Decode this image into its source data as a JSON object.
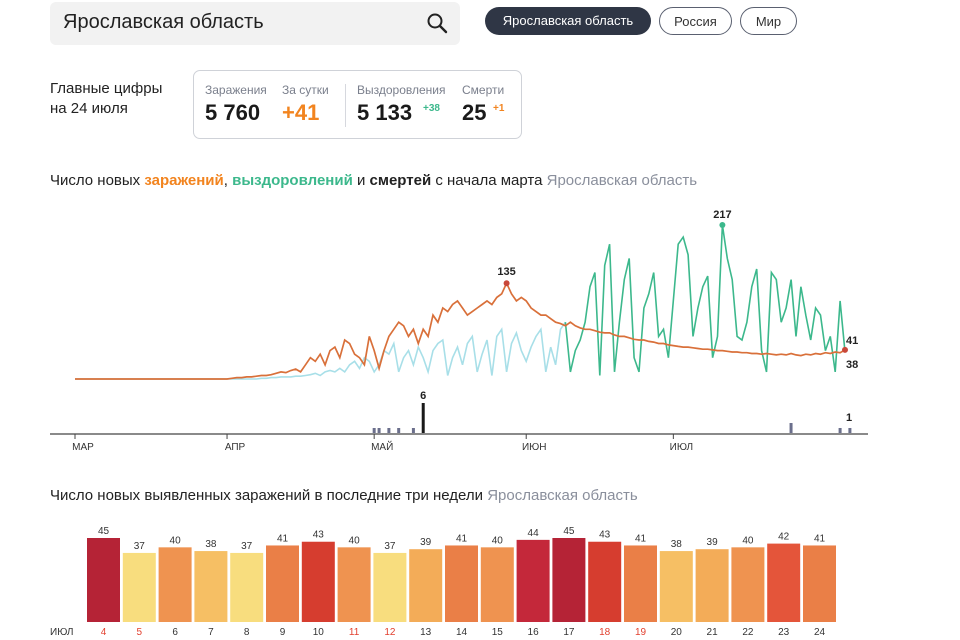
{
  "search": {
    "value": "Ярославская область"
  },
  "region_tabs": [
    {
      "label": "Ярославская область",
      "active": true
    },
    {
      "label": "Россия",
      "active": false
    },
    {
      "label": "Мир",
      "active": false
    }
  ],
  "stats": {
    "title_line1": "Главные цифры",
    "title_line2": "на 24 июля",
    "infections_label": "Заражения",
    "infections_value": "5 760",
    "daily_label": "За сутки",
    "daily_value": "+41",
    "recoveries_label": "Выздоровления",
    "recoveries_value": "5 133",
    "recoveries_delta": "+38",
    "deaths_label": "Смерти",
    "deaths_value": "25",
    "deaths_delta": "+1"
  },
  "chart1_title": {
    "part1": "Число новых ",
    "infections": "заражений",
    "comma": ", ",
    "recoveries": "выздоровлений",
    "and": " и ",
    "deaths": "смертей",
    "part2": " с начала марта",
    "region": "Ярославская область"
  },
  "chart2_title": {
    "text": "Число новых выявленных заражений в последние три недели",
    "region": "Ярославская область"
  },
  "colors": {
    "infections": "#f2841f",
    "recoveries": "#3cb88c",
    "recoveries_light": "#a8dfe8",
    "deaths": "#2f3645"
  },
  "chart_data": [
    {
      "type": "line",
      "x_ticks": [
        "МАР",
        "АПР",
        "МАЙ",
        "ИЮН",
        "ИЮЛ"
      ],
      "series": [
        {
          "name": "заражений",
          "key": "infections",
          "values": [
            0,
            0,
            0,
            0,
            0,
            0,
            0,
            0,
            0,
            0,
            0,
            0,
            0,
            0,
            0,
            0,
            0,
            0,
            0,
            0,
            0,
            0,
            0,
            0,
            0,
            0,
            0,
            0,
            0,
            0,
            0,
            0,
            1,
            2,
            2,
            3,
            3,
            4,
            5,
            5,
            6,
            8,
            10,
            9,
            12,
            14,
            10,
            20,
            30,
            25,
            35,
            20,
            40,
            45,
            30,
            55,
            50,
            35,
            30,
            20,
            60,
            40,
            15,
            40,
            60,
            70,
            80,
            75,
            60,
            70,
            50,
            70,
            60,
            90,
            80,
            100,
            95,
            105,
            110,
            100,
            90,
            95,
            100,
            105,
            110,
            105,
            115,
            120,
            135,
            120,
            110,
            115,
            110,
            100,
            95,
            90,
            90,
            85,
            80,
            78,
            75,
            80,
            75,
            72,
            70,
            70,
            68,
            66,
            65,
            65,
            62,
            60,
            60,
            58,
            56,
            55,
            55,
            53,
            52,
            50,
            50,
            48,
            47,
            46,
            45,
            45,
            44,
            43,
            42,
            42,
            41,
            40,
            40,
            39,
            38,
            38,
            37,
            37,
            36,
            36,
            35,
            36,
            35,
            34,
            35,
            34,
            36,
            34,
            33,
            35,
            34,
            36,
            35,
            37,
            36,
            38,
            37,
            41
          ]
        },
        {
          "name": "выздоровлений",
          "key": "recoveries",
          "values": [
            0,
            0,
            0,
            0,
            0,
            0,
            0,
            0,
            0,
            0,
            0,
            0,
            0,
            0,
            0,
            0,
            0,
            0,
            0,
            0,
            0,
            0,
            0,
            0,
            0,
            0,
            0,
            0,
            0,
            0,
            0,
            0,
            0,
            0,
            0,
            0,
            0,
            0,
            1,
            1,
            2,
            2,
            3,
            3,
            3,
            4,
            4,
            5,
            6,
            8,
            5,
            10,
            12,
            10,
            15,
            10,
            20,
            25,
            15,
            30,
            25,
            10,
            20,
            40,
            35,
            50,
            10,
            30,
            40,
            20,
            45,
            30,
            10,
            40,
            50,
            55,
            5,
            30,
            45,
            20,
            50,
            60,
            10,
            35,
            55,
            5,
            60,
            70,
            10,
            50,
            65,
            40,
            25,
            45,
            60,
            70,
            10,
            45,
            20,
            70,
            80,
            10,
            40,
            55,
            80,
            130,
            150,
            5,
            160,
            190,
            10,
            80,
            140,
            170,
            30,
            10,
            100,
            120,
            150,
            60,
            70,
            30,
            110,
            190,
            200,
            175,
            60,
            100,
            130,
            145,
            30,
            60,
            217,
            170,
            140,
            60,
            55,
            80,
            130,
            155,
            40,
            10,
            150,
            140,
            80,
            100,
            140,
            60,
            130,
            90,
            55,
            100,
            90,
            40,
            60,
            10,
            110,
            38
          ]
        },
        {
          "name": "смертей",
          "key": "deaths",
          "values": [
            0,
            0,
            0,
            0,
            0,
            0,
            0,
            0,
            0,
            0,
            0,
            0,
            0,
            0,
            0,
            0,
            0,
            0,
            0,
            0,
            0,
            0,
            0,
            0,
            0,
            0,
            0,
            0,
            0,
            0,
            0,
            0,
            0,
            0,
            0,
            0,
            0,
            0,
            0,
            0,
            0,
            0,
            0,
            0,
            0,
            0,
            0,
            0,
            0,
            0,
            0,
            0,
            0,
            0,
            0,
            0,
            0,
            0,
            0,
            0,
            0,
            1,
            1,
            0,
            1,
            0,
            1,
            0,
            0,
            1,
            0,
            6,
            0,
            0,
            0,
            0,
            0,
            0,
            0,
            0,
            0,
            0,
            0,
            0,
            0,
            0,
            0,
            0,
            0,
            0,
            0,
            0,
            0,
            0,
            0,
            0,
            0,
            0,
            0,
            0,
            0,
            0,
            0,
            0,
            0,
            0,
            0,
            0,
            0,
            0,
            0,
            0,
            0,
            0,
            0,
            0,
            0,
            0,
            0,
            0,
            0,
            0,
            0,
            0,
            0,
            0,
            0,
            0,
            0,
            0,
            0,
            0,
            0,
            0,
            0,
            0,
            0,
            0,
            0,
            0,
            0,
            0,
            0,
            0,
            0,
            0,
            2,
            0,
            0,
            0,
            0,
            0,
            0,
            0,
            0,
            0,
            1,
            0,
            1
          ]
        }
      ],
      "annotations": [
        "217",
        "135",
        "41",
        "38",
        "6",
        "1"
      ],
      "ylim": [
        0,
        217
      ]
    },
    {
      "type": "bar",
      "month_label": "ИЮЛ",
      "categories": [
        "4",
        "5",
        "6",
        "7",
        "8",
        "9",
        "10",
        "11",
        "12",
        "13",
        "14",
        "15",
        "16",
        "17",
        "18",
        "19",
        "20",
        "21",
        "22",
        "23",
        "24"
      ],
      "values": [
        45,
        37,
        40,
        38,
        37,
        41,
        43,
        40,
        37,
        39,
        41,
        40,
        44,
        45,
        43,
        41,
        38,
        39,
        40,
        42,
        41
      ],
      "weekend_days": [
        "4",
        "5",
        "11",
        "12",
        "18",
        "19"
      ],
      "ylim": [
        0,
        45
      ]
    }
  ]
}
